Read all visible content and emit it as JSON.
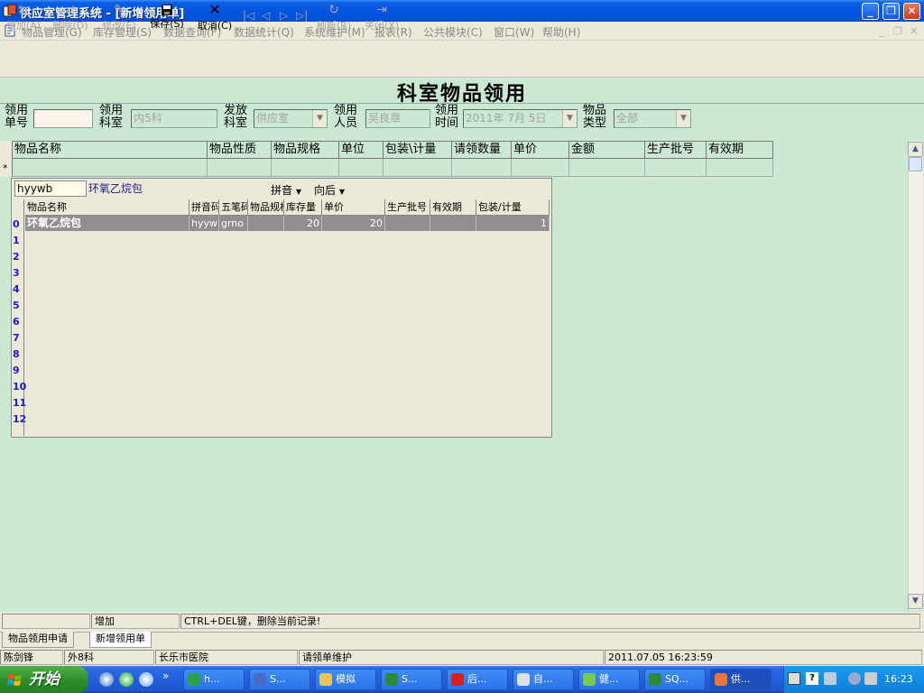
{
  "window": {
    "title": "供应室管理系统 - [新增领用单]",
    "controls": {
      "minimize": "_",
      "restore": "❐",
      "close": "✕"
    }
  },
  "menu": [
    {
      "label": "物品管理(G)"
    },
    {
      "label": "库存管理(S)"
    },
    {
      "label": "数据查询(F)"
    },
    {
      "label": "数据统计(Q)"
    },
    {
      "label": "系统维护(M)"
    },
    {
      "label": "报表(R)"
    },
    {
      "label": "公共模块(C)"
    },
    {
      "label": "窗口(W)"
    },
    {
      "label": "帮助(H)"
    }
  ],
  "toolbar": {
    "add": "增加(A)",
    "delete": "删除(D)",
    "modify": "修改(E)",
    "save": "保存(S)",
    "cancel": "取消(C)",
    "refresh": "刷新(R)",
    "close": "关闭(X)",
    "nav": {
      "first": "|◁",
      "prev": "◁",
      "next": "▷",
      "last": "▷|"
    }
  },
  "form": {
    "title": "科室物品领用",
    "fields": {
      "order_no": {
        "label": "领用单号",
        "value": ""
      },
      "dept": {
        "label": "领用科室",
        "value": "内5科"
      },
      "issue_dept": {
        "label": "发放科室",
        "value": "供应室"
      },
      "person": {
        "label": "领用人员",
        "value": "吴良章"
      },
      "time": {
        "label": "领用时间",
        "value": "2011年 7月 5日"
      },
      "category": {
        "label": "物品类型",
        "value": "全部"
      }
    }
  },
  "grid": {
    "columns": [
      "物品名称",
      "物品性质",
      "物品规格",
      "单位",
      "包装\\计量",
      "请领数量",
      "单价",
      "金额",
      "生产批号",
      "有效期"
    ],
    "new_row_marker": "*"
  },
  "popup": {
    "search_value": "hyywb",
    "match_name": "环氧乙烷包",
    "mode": "拼音",
    "direction": "向后",
    "columns": [
      "物品名称",
      "拼音码",
      "五笔码",
      "物品规格",
      "库存量",
      "单价",
      "生产批号",
      "有效期",
      "包装/计量"
    ],
    "rows": [
      {
        "name": "环氧乙烷包",
        "pinyin": "hyyw",
        "wubi": "grno",
        "spec": "",
        "stock": "20",
        "price": "20",
        "batch": "",
        "expiry": "",
        "pack": "1"
      }
    ],
    "row_numbers": [
      "0",
      "1",
      "2",
      "3",
      "4",
      "5",
      "6",
      "7",
      "8",
      "9",
      "10",
      "11",
      "12"
    ]
  },
  "status": {
    "mode": "增加",
    "hint": "CTRL+DEL键，删除当前记录!",
    "tabs": [
      "物品领用申请",
      "新增领用单"
    ],
    "user": "陈剑锋",
    "dept": "外8科",
    "hospital": "长乐市医院",
    "module": "请领单维护",
    "datetime": "2011.07.05 16:23:59"
  },
  "taskbar": {
    "start": "开始",
    "tasks": [
      "h...",
      "S...",
      "模拟",
      "S...",
      "后...",
      "自...",
      "健...",
      "SQ...",
      "供..."
    ],
    "clock": "16:23",
    "quicklaunch_more": "»"
  },
  "colors": {
    "form_bg": "#cbe8d2",
    "titlebar": "#0454e0",
    "selection": "#8f8f8f",
    "rownum": "#1a1ad0"
  }
}
